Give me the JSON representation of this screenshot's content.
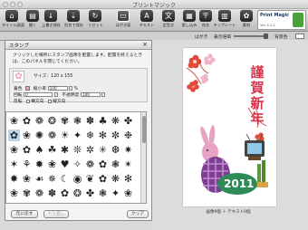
{
  "window": {
    "title": "プリントマジック"
  },
  "toolbar": {
    "items": [
      {
        "label": "タイトル画面",
        "icon": "home-icon"
      },
      {
        "label": "開く",
        "icon": "open-icon"
      },
      {
        "label": "上書き保存",
        "icon": "save-icon"
      },
      {
        "label": "別名で保存",
        "icon": "save-as-icon"
      },
      {
        "label": "リセット",
        "icon": "reset-icon"
      },
      {
        "label": "はがき面",
        "icon": "card-face-icon"
      },
      {
        "label": "テキスト",
        "icon": "text-icon"
      },
      {
        "label": "定型文",
        "icon": "template-text-icon"
      },
      {
        "label": "差し込み",
        "icon": "merge-icon"
      },
      {
        "label": "宛名",
        "icon": "address-icon"
      },
      {
        "label": "テンプレート",
        "icon": "template-icon"
      },
      {
        "label": "素材",
        "icon": "material-icon"
      }
    ],
    "version": "Ver 4.1.1",
    "logo_text": "Print Magic"
  },
  "subbar": {
    "postcard_label": "はがき",
    "zoom_label": "表示倍率",
    "bg_label": "背景色"
  },
  "panel": {
    "title": "スタンプ",
    "instructions": "クリックした場所にスタンプ画像を配置します。配置を終えるときは、このパネルを閉じてください。",
    "size_label": "サイズ：",
    "size_value": "120 x 155",
    "color_label": "着色",
    "scale_label": "縮小率",
    "scale_value": "100",
    "scale_unit": "%",
    "rotate_label": "回転",
    "rotate_value": "0",
    "opacity_label": "不透明度",
    "opacity_value": "100",
    "flip_label": "反転",
    "flip_h": "横方向",
    "flip_v": "縦方向",
    "undo_label": "元に戻す",
    "redo_label": "やり直し",
    "clear_label": "クリア"
  },
  "canvas": {
    "greeting": "謹賀新年",
    "year": "2011",
    "status": "画像9個 ＋ テキスト0個"
  },
  "colors": {
    "accent": "#d8334a",
    "selected": "#bcd6ef",
    "red": "#e24a3b",
    "pink": "#e7a3c4",
    "purple": "#7a3e8d"
  }
}
